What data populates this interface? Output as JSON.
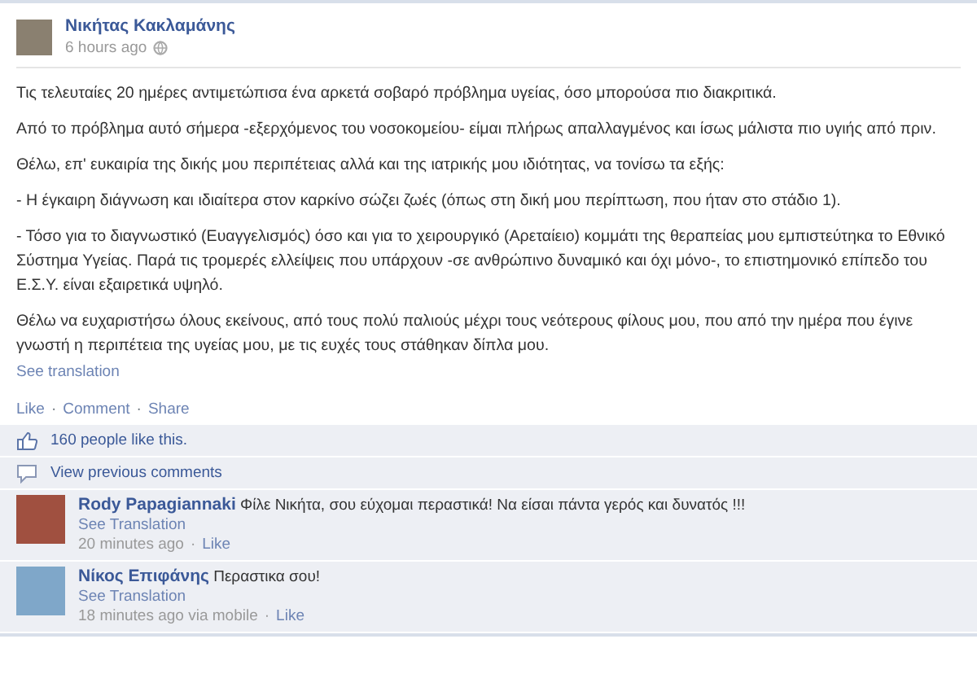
{
  "post": {
    "author": "Νικήτας Κακλαμάνης",
    "time": "6 hours ago",
    "paragraphs": [
      "Τις τελευταίες 20 ημέρες αντιμετώπισα ένα αρκετά σοβαρό πρόβλημα υγείας, όσο μπορούσα πιο διακριτικά.",
      "Από το πρόβλημα αυτό σήμερα -εξερχόμενος του νοσοκομείου- είμαι πλήρως απαλλαγμένος και ίσως μάλιστα πιο υγιής από πριν.",
      "Θέλω, επ' ευκαιρία της δικής μου περιπέτειας αλλά και της ιατρικής μου ιδιότητας, να τονίσω τα εξής:",
      "- Η έγκαιρη διάγνωση και ιδιαίτερα στον καρκίνο σώζει ζωές (όπως στη δική μου περίπτωση, που ήταν στο στάδιο 1).",
      "- Τόσο για το διαγνωστικό (Ευαγγελισμός) όσο και για το χειρουργικό (Αρεταίειο) κομμάτι της θεραπείας μου εμπιστεύτηκα το Εθνικό Σύστημα Υγείας. Παρά τις τρομερές ελλείψεις που υπάρχουν -σε ανθρώπινο δυναμικό και όχι μόνο-, το επιστημονικό επίπεδο του Ε.Σ.Υ. είναι εξαιρετικά υψηλό.",
      "Θέλω να ευχαριστήσω όλους εκείνους, από τους πολύ παλιούς μέχρι τους νεότερους φίλους μου, που από την ημέρα που έγινε γνωστή η περιπέτεια της υγείας μου, με τις ευχές τους στάθηκαν δίπλα μου."
    ],
    "see_translation": "See translation"
  },
  "actions": [
    "Like",
    "Comment",
    "Share"
  ],
  "separator": "·",
  "likes": "160 people like this.",
  "view_previous": "View previous comments",
  "comments": [
    {
      "author": "Rody Papagiannaki",
      "text": "Φίλε Νικήτα, σου εύχομαι περαστικά! Να είσαι πάντα γερός και δυνατός !!!",
      "translate": "See Translation",
      "time": "20 minutes ago",
      "like": "Like"
    },
    {
      "author": "Νίκος Επιφάνης",
      "text": "Περαστικα σου!",
      "translate": "See Translation",
      "time": "18 minutes ago via mobile",
      "like": "Like"
    }
  ]
}
